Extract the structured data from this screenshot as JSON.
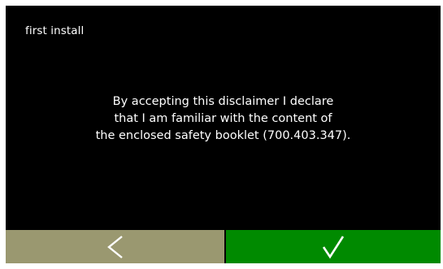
{
  "screen": {
    "title": "first install",
    "message_lines": [
      "By accepting this disclaimer I declare",
      "that I am familiar with the content of",
      "the enclosed safety booklet (700.403.347)."
    ]
  },
  "buttons": {
    "back": {
      "icon": "chevron-left-icon",
      "color": "#9a9870"
    },
    "accept": {
      "icon": "checkmark-icon",
      "color": "#008a00"
    }
  },
  "colors": {
    "background": "#000000",
    "text": "#ffffff",
    "frame": "#ffffff"
  }
}
